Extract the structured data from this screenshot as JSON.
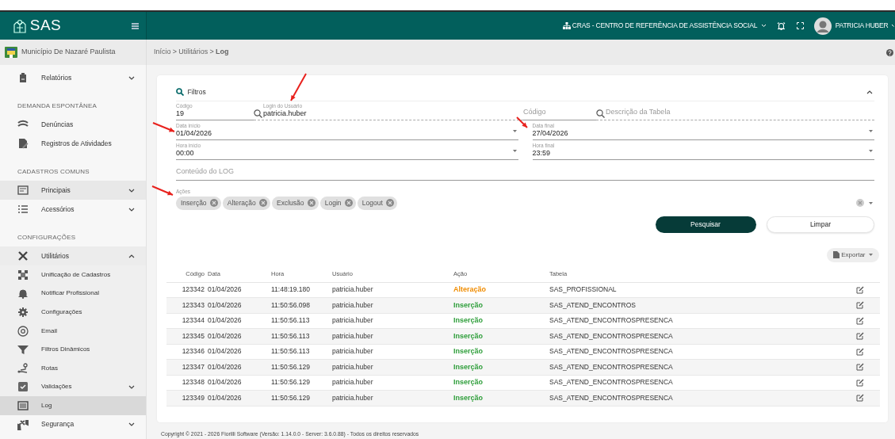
{
  "header": {
    "app_name": "SAS",
    "unit": "CRAS - CENTRO DE REFERÊNCIA DE ASSISTÊNCIA SOCIAL",
    "user": "PATRICIA HUBER"
  },
  "municipality": "Município De Nazaré Paulista",
  "breadcrumb": {
    "items": [
      "Início",
      "Utilitários",
      "Log"
    ],
    "separator": ">"
  },
  "sidebar": [
    {
      "kind": "item",
      "label": "Relatórios",
      "expandable": true,
      "expanded": false,
      "selected": false,
      "hovered": false
    },
    {
      "kind": "section",
      "label": "DEMANDA ESPONTÂNEA"
    },
    {
      "kind": "item",
      "label": "Denúncias",
      "expandable": false,
      "selected": false,
      "hovered": false
    },
    {
      "kind": "item",
      "label": "Registros de Atividades",
      "expandable": false,
      "selected": false,
      "hovered": false
    },
    {
      "kind": "section",
      "label": "CADASTROS COMUNS"
    },
    {
      "kind": "item",
      "label": "Principais",
      "expandable": true,
      "expanded": false,
      "selected": false,
      "hovered": true
    },
    {
      "kind": "item",
      "label": "Acessórios",
      "expandable": true,
      "expanded": false,
      "selected": false,
      "hovered": false
    },
    {
      "kind": "section",
      "label": "CONFIGURAÇÕES"
    },
    {
      "kind": "item",
      "label": "Utilitários",
      "expandable": true,
      "expanded": true,
      "selected": false,
      "hovered": false,
      "children": [
        {
          "label": "Unificação de Cadastros",
          "expandable": false,
          "selected": false
        },
        {
          "label": "Notificar Profissional",
          "expandable": false,
          "selected": false
        },
        {
          "label": "Configurações",
          "expandable": false,
          "selected": false
        },
        {
          "label": "Email",
          "expandable": false,
          "selected": false
        },
        {
          "label": "Filtros Dinâmicos",
          "expandable": false,
          "selected": false
        },
        {
          "label": "Rotas",
          "expandable": false,
          "selected": false
        },
        {
          "label": "Validações",
          "expandable": true,
          "expanded": false,
          "selected": false
        },
        {
          "label": "Log",
          "expandable": false,
          "selected": true
        }
      ]
    },
    {
      "kind": "item",
      "label": "Segurança",
      "expandable": true,
      "expanded": false,
      "selected": false,
      "hovered": false
    }
  ],
  "filters": {
    "title": "Filtros",
    "expanded": true,
    "codigo": {
      "label": "Código",
      "value": "19"
    },
    "login": {
      "label": "Login do Usuário",
      "value": "patricia.huber"
    },
    "tabela_codigo": {
      "placeholder": "Código"
    },
    "tabela_descricao": {
      "placeholder": "Descrição da Tabela"
    },
    "data_inicio": {
      "label": "Data início",
      "value": "01/04/2026"
    },
    "data_final": {
      "label": "Data final",
      "value": "27/04/2026"
    },
    "hora_inicio": {
      "label": "Hora início",
      "value": "00:00"
    },
    "hora_final": {
      "label": "Hora final",
      "value": "23:59"
    },
    "conteudo": {
      "placeholder": "Conteúdo do LOG"
    },
    "acoes": {
      "label": "Ações",
      "chips": [
        "Inserção",
        "Alteração",
        "Exclusão",
        "Login",
        "Logout"
      ]
    },
    "buttons": {
      "search": "Pesquisar",
      "clear": "Limpar"
    }
  },
  "export_button": "Exportar",
  "table": {
    "columns": [
      "Código",
      "Data",
      "Hora",
      "Usuário",
      "Ação",
      "Tabela"
    ],
    "rows": [
      {
        "cells": [
          "123342",
          "01/04/2026",
          "11:48:19.180",
          "patricia.huber",
          "Alteração",
          "SAS_PROFISSIONAL"
        ],
        "color": "#f08c00"
      },
      {
        "cells": [
          "123343",
          "01/04/2026",
          "11:50:56.098",
          "patricia.huber",
          "Inserção",
          "SAS_ATEND_ENCONTROS"
        ],
        "color": "#2e9e3a"
      },
      {
        "cells": [
          "123344",
          "01/04/2026",
          "11:50:56.113",
          "patricia.huber",
          "Inserção",
          "SAS_ATEND_ENCONTROSPRESENCA"
        ],
        "color": "#2e9e3a"
      },
      {
        "cells": [
          "123345",
          "01/04/2026",
          "11:50:56.113",
          "patricia.huber",
          "Inserção",
          "SAS_ATEND_ENCONTROSPRESENCA"
        ],
        "color": "#2e9e3a"
      },
      {
        "cells": [
          "123346",
          "01/04/2026",
          "11:50:56.113",
          "patricia.huber",
          "Inserção",
          "SAS_ATEND_ENCONTROSPRESENCA"
        ],
        "color": "#2e9e3a"
      },
      {
        "cells": [
          "123347",
          "01/04/2026",
          "11:50:56.129",
          "patricia.huber",
          "Inserção",
          "SAS_ATEND_ENCONTROSPRESENCA"
        ],
        "color": "#2e9e3a"
      },
      {
        "cells": [
          "123348",
          "01/04/2026",
          "11:50:56.129",
          "patricia.huber",
          "Inserção",
          "SAS_ATEND_ENCONTROSPRESENCA"
        ],
        "color": "#2e9e3a"
      },
      {
        "cells": [
          "123349",
          "01/04/2026",
          "11:50:56.129",
          "patricia.huber",
          "Inserção",
          "SAS_ATEND_ENCONTROSPRESENCA"
        ],
        "color": "#2e9e3a"
      }
    ]
  },
  "footer": "Copyright © 2021 - 2026 Fiorilli Software (Versão: 1.14.0.0 - Server: 3.6.0.88) - Todos os direitos reservados"
}
